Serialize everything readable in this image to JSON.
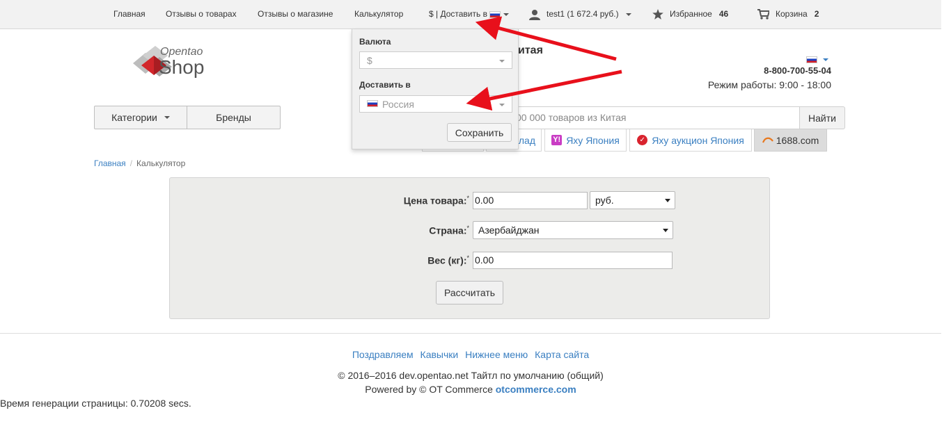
{
  "nav": {
    "home": "Главная",
    "product_reviews": "Отзывы о товарах",
    "store_reviews": "Отзывы о магазине",
    "calculator": "Калькулятор",
    "currency_delivery": "$ | Доставить в",
    "user": "test1 (1 672.4 руб.)",
    "favorites_label": "Избранное",
    "favorites_count": "46",
    "cart_label": "Корзина",
    "cart_count": "2"
  },
  "logo": {
    "line1": "Opentao",
    "line2": "Shop"
  },
  "header": {
    "title_fragment": "итая",
    "phone": "8-800-700-55-04",
    "hours": "Режим работы: 9:00 - 18:00"
  },
  "catalog": {
    "categories": "Категории",
    "brands": "Бренды"
  },
  "search": {
    "placeholder": "00 000 товаров из Китая",
    "button": "Найти"
  },
  "source_tabs": [
    {
      "label": "алад"
    },
    {
      "label": "Яху Япония",
      "icon": "Y!"
    },
    {
      "label": "Яху аукцион Япония"
    },
    {
      "label": "1688.com"
    }
  ],
  "breadcrumb": {
    "home": "Главная",
    "current": "Калькулятор"
  },
  "calc": {
    "price_label": "Цена товара:",
    "price_value": "0.00",
    "currency_value": "руб.",
    "country_label": "Страна:",
    "country_value": "Азербайджан",
    "weight_label": "Вес (кг):",
    "weight_value": "0.00",
    "required_mark": "*",
    "submit": "Рассчитать"
  },
  "dropdown": {
    "currency_label": "Валюта",
    "currency_value": "$",
    "delivery_label": "Доставить в",
    "delivery_value": "Россия",
    "save": "Сохранить"
  },
  "footer": {
    "links": [
      "Поздравляем",
      "Кавычки",
      "Нижнее меню",
      "Карта сайта"
    ],
    "copyright": "© 2016–2016 dev.opentao.net Тайтл по умолчанию (общий)",
    "powered_prefix": "Powered by © OT Commerce",
    "powered_link": "otcommerce.com",
    "generation": "Время генерации страницы: 0.70208 secs."
  },
  "colors": {
    "link": "#3a7fc1",
    "arrow": "#e8101b",
    "logo_red": "#d2262b"
  }
}
